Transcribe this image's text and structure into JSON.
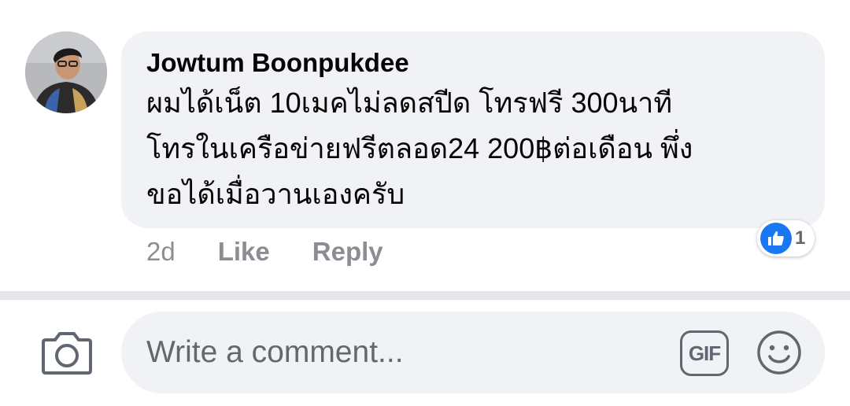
{
  "comment": {
    "author": "Jowtum Boonpukdee",
    "text_lines": [
      "ผมได้เน็ต 10เมคไม่ลดสปีด  โทรฟรี 300นาที",
      "โทรในเครือข่ายฟรีตลอด24  200฿ต่อเดือน  พึ่ง",
      "ขอได้เมื่อวานเองครับ"
    ],
    "age": "2d",
    "like_label": "Like",
    "reply_label": "Reply",
    "reaction_count": "1",
    "reaction_type": "like-icon"
  },
  "composer": {
    "placeholder": "Write a comment...",
    "gif_label": "GIF",
    "camera_icon": "camera-icon",
    "emoji_icon": "emoji-icon"
  },
  "colors": {
    "bubble": "#f0f2f5",
    "text": "#050505",
    "meta": "#8a8d91",
    "like_blue": "#1877f2"
  }
}
